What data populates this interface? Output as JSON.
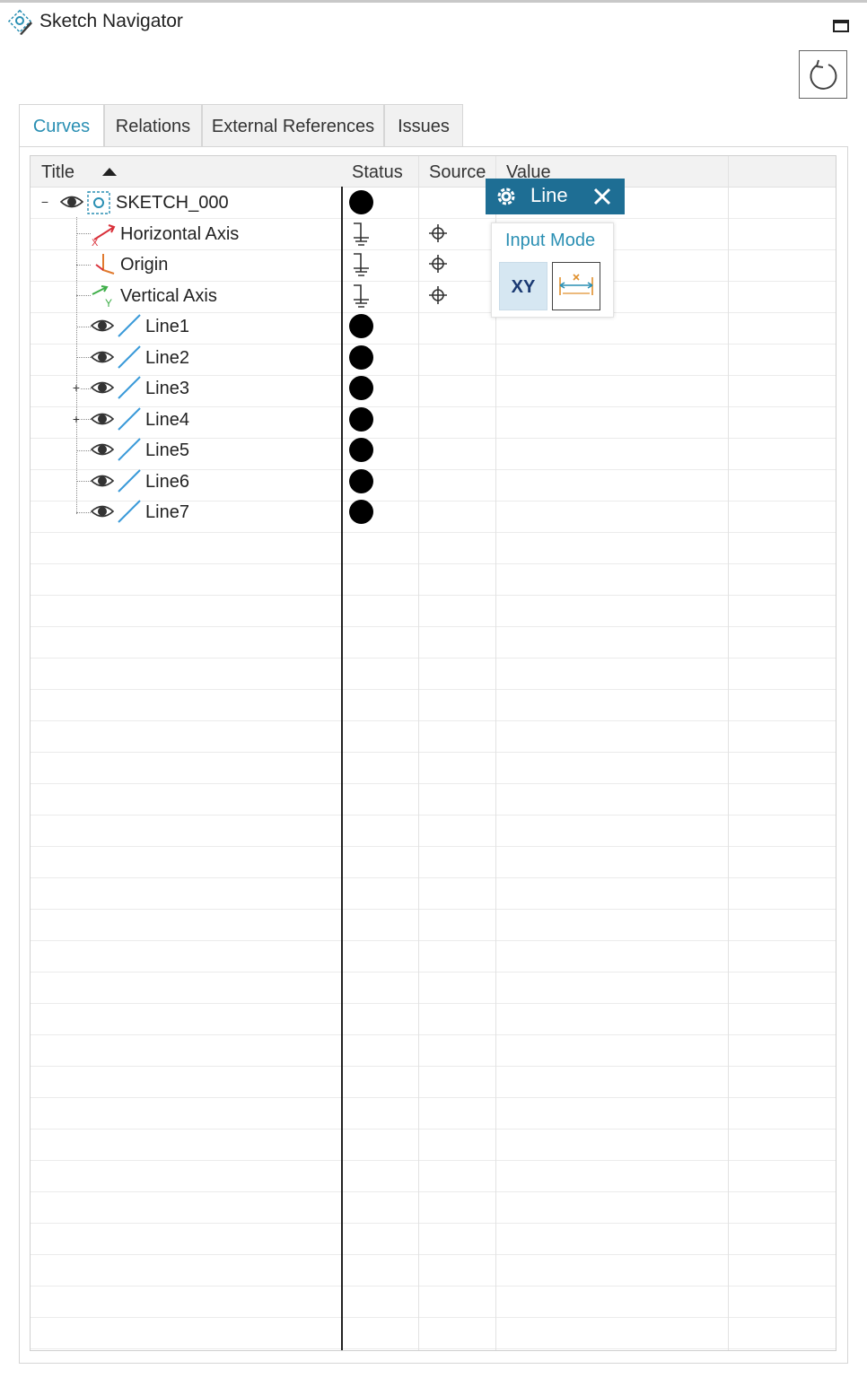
{
  "window": {
    "title": "Sketch Navigator",
    "app_icon": "sketch-navigator-icon",
    "maximize_icon": "maximize-icon",
    "reset_icon": "undo-rotate-icon"
  },
  "tabs": [
    {
      "label": "Curves",
      "active": true
    },
    {
      "label": "Relations",
      "active": false
    },
    {
      "label": "External References",
      "active": false
    },
    {
      "label": "Issues",
      "active": false
    }
  ],
  "columns": {
    "title": "Title",
    "status": "Status",
    "source": "Source",
    "value": "Value",
    "sort": "ascending"
  },
  "tree": {
    "root": {
      "label": "SKETCH_000",
      "expanded": true,
      "status": "filled-circle"
    },
    "items": [
      {
        "label": "Horizontal Axis",
        "icon": "horizontal-axis-icon",
        "status": "ground-icon",
        "source": "target-icon"
      },
      {
        "label": "Origin",
        "icon": "origin-icon",
        "status": "ground-icon",
        "source": "target-icon"
      },
      {
        "label": "Vertical Axis",
        "icon": "vertical-axis-icon",
        "status": "ground-icon",
        "source": "target-icon"
      },
      {
        "label": "Line1",
        "icon": "line-icon",
        "status": "filled-circle",
        "expandable": false
      },
      {
        "label": "Line2",
        "icon": "line-icon",
        "status": "filled-circle",
        "expandable": false
      },
      {
        "label": "Line3",
        "icon": "line-icon",
        "status": "filled-circle",
        "expandable": true
      },
      {
        "label": "Line4",
        "icon": "line-icon",
        "status": "filled-circle",
        "expandable": true
      },
      {
        "label": "Line5",
        "icon": "line-icon",
        "status": "filled-circle",
        "expandable": false
      },
      {
        "label": "Line6",
        "icon": "line-icon",
        "status": "filled-circle",
        "expandable": false
      },
      {
        "label": "Line7",
        "icon": "line-icon",
        "status": "filled-circle",
        "expandable": false
      }
    ]
  },
  "popup": {
    "title": "Line",
    "gear_icon": "gear-icon",
    "close_icon": "close-icon",
    "input_mode_label": "Input Mode",
    "xy_label": "XY",
    "length_icon": "length-dimension-icon"
  },
  "colors": {
    "accent": "#2a8fb3",
    "popup_header": "#1e6e94",
    "xy_selected": "#d6e7f2",
    "axis_red": "#d9303a",
    "axis_green": "#3fae49",
    "line_blue": "#3a9ad9"
  }
}
